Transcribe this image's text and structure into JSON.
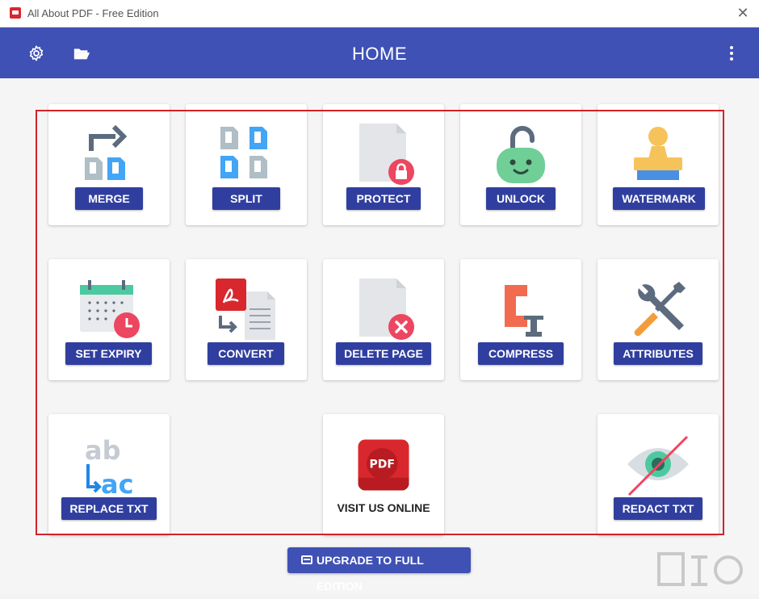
{
  "window": {
    "title": "All About PDF - Free Edition",
    "close_icon": "close-icon"
  },
  "header": {
    "title": "HOME",
    "left_icons": [
      "gear-icon",
      "folder-open-icon"
    ],
    "right_icon": "more-vert-icon"
  },
  "tiles": [
    {
      "label": "MERGE",
      "icon": "merge-icon"
    },
    {
      "label": "SPLIT",
      "icon": "split-icon"
    },
    {
      "label": "PROTECT",
      "icon": "protect-icon"
    },
    {
      "label": "UNLOCK",
      "icon": "unlock-icon"
    },
    {
      "label": "WATERMARK",
      "icon": "stamp-icon"
    },
    {
      "label": "SET EXPIRY",
      "icon": "calendar-clock-icon"
    },
    {
      "label": "CONVERT",
      "icon": "convert-icon"
    },
    {
      "label": "DELETE PAGE",
      "icon": "delete-page-icon"
    },
    {
      "label": "COMPRESS",
      "icon": "clamp-icon"
    },
    {
      "label": "ATTRIBUTES",
      "icon": "tools-icon"
    },
    {
      "label": "REPLACE TXT",
      "icon": "replace-text-icon"
    },
    {
      "label": "VISIT US ONLINE",
      "icon": "pdf-logo-icon"
    },
    {
      "label": "REDACT TXT",
      "icon": "redact-eye-icon"
    }
  ],
  "footer": {
    "upgrade_label": "UPGRADE TO FULL EDITION"
  },
  "colors": {
    "header": "#3f51b5",
    "button": "#303f9f",
    "highlight_box": "#d32229"
  }
}
